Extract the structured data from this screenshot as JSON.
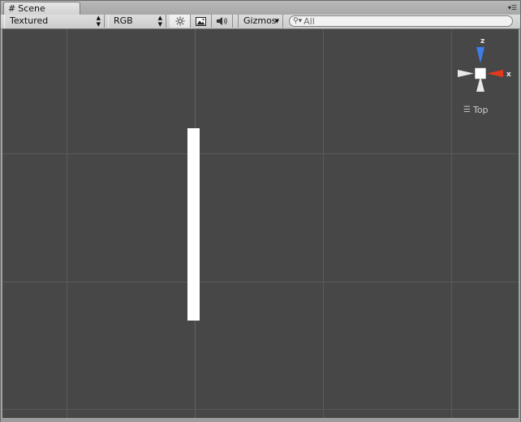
{
  "window": {
    "tab_label": "Scene",
    "tab_icon": "grid-icon",
    "menu_icon": "window-menu-icon"
  },
  "toolbar": {
    "shading_mode": "Textured",
    "render_mode": "RGB",
    "lighting_icon": "sun-icon",
    "effects_icon": "image-icon",
    "audio_icon": "speaker-icon",
    "gizmos_label": "Gizmos",
    "search_placeholder": "All"
  },
  "viewport": {
    "background_color": "#474747",
    "view_label": "Top",
    "gizmo": {
      "z_label": "z",
      "x_label": "x",
      "z_color": "#3f7de8",
      "x_color": "#e3391c"
    }
  }
}
